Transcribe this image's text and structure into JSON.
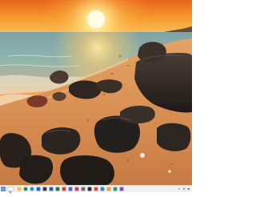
{
  "desktop": {
    "wallpaper": "sunset-beach-rocks",
    "colors": {
      "sky_top": "#f07a1a",
      "sun": "#fff3b0",
      "sea": "#6fa3a8",
      "sand": "#d9925a",
      "rock": "#2a2522"
    }
  },
  "taskbar": {
    "background": "#eef0f4",
    "apps": [
      {
        "icon": "file-explorer-icon",
        "color": "#f2c14e"
      },
      {
        "icon": "chrome-icon",
        "color": "#2e8b3e"
      },
      {
        "icon": "edge-icon",
        "color": "#1f8fd6"
      },
      {
        "icon": "mail-icon",
        "color": "#2a66c8"
      },
      {
        "icon": "store-icon",
        "color": "#3a3a3a"
      },
      {
        "icon": "word-icon",
        "color": "#2b5bb7"
      },
      {
        "icon": "excel-icon",
        "color": "#1f7a45"
      },
      {
        "icon": "powerpoint-icon",
        "color": "#d24726"
      },
      {
        "icon": "teams-icon",
        "color": "#5b5fc7"
      },
      {
        "icon": "photos-icon",
        "color": "#c43f6b"
      },
      {
        "icon": "settings-icon",
        "color": "#6b6b6b"
      },
      {
        "icon": "terminal-icon",
        "color": "#2b2b2b"
      },
      {
        "icon": "app-icon",
        "color": "#e04a3a"
      },
      {
        "icon": "app-icon",
        "color": "#2f86d6"
      },
      {
        "icon": "app-icon",
        "color": "#e8a23a"
      },
      {
        "icon": "app-icon",
        "color": "#3b9b5c"
      },
      {
        "icon": "app-icon",
        "color": "#7d4fc4"
      }
    ],
    "tray": {
      "icons": [
        "chevron-up-icon",
        "wifi-icon",
        "volume-icon"
      ]
    }
  }
}
